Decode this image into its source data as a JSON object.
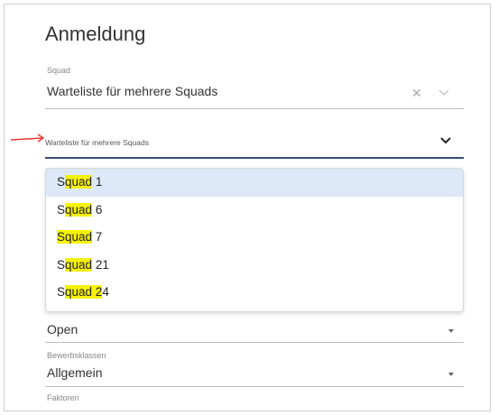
{
  "dialog": {
    "title": "Anmeldung"
  },
  "squad_field": {
    "label": "Squad",
    "value": "Warteliste für mehrere Squads",
    "clear_icon": "close-icon",
    "toggle_icon": "chevron-down-icon"
  },
  "second_select": {
    "value": "Warteliste für mehrere Squads",
    "toggle_icon": "chevron-down-icon",
    "annotation": "red-arrow"
  },
  "options": [
    {
      "prefix": "S",
      "highlight": "quad",
      "suffix": " 1"
    },
    {
      "prefix": "S",
      "highlight": "quad",
      "suffix": " 6"
    },
    {
      "prefix": "",
      "highlight": "Squad",
      "suffix": " 7"
    },
    {
      "prefix": "S",
      "highlight": "quad",
      "suffix": " 21"
    },
    {
      "prefix": "S",
      "highlight": "quad 2",
      "suffix": "4"
    }
  ],
  "category_field": {
    "value": "Open"
  },
  "class_field": {
    "label": "Bewerbsklassen",
    "value": "Allgemein"
  },
  "factors_field": {
    "label": "Faktoren"
  },
  "colors": {
    "accent_line": "#3a4a7a",
    "highlight": "#f6f20a",
    "active_option": "#dde9f8",
    "arrow": "#e53935"
  }
}
